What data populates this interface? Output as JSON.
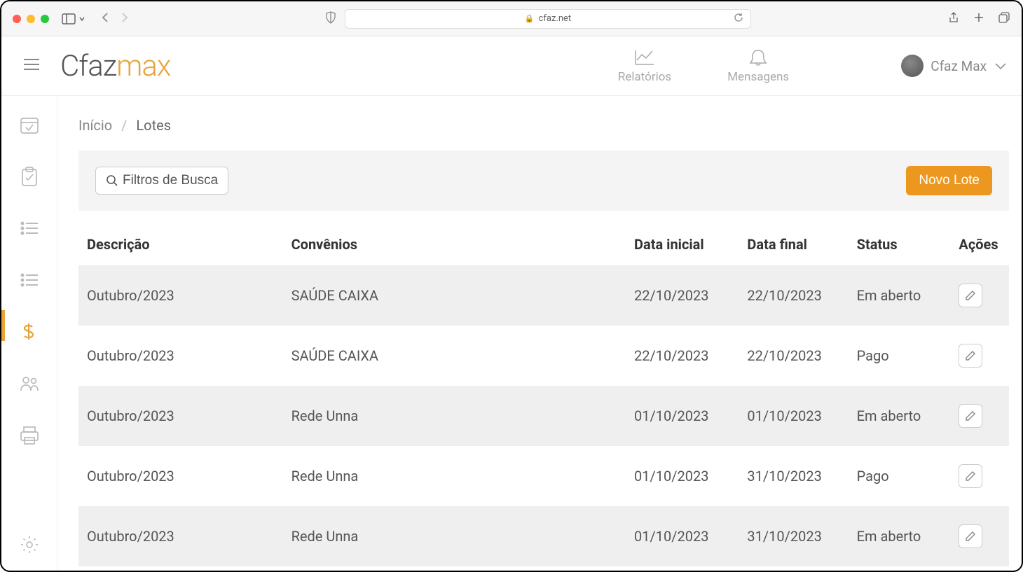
{
  "browser": {
    "url": "cfaz.net"
  },
  "logo": {
    "part1": "Cfaz",
    "part2": "max"
  },
  "header_nav": {
    "reports": "Relatórios",
    "messages": "Mensagens"
  },
  "user": {
    "name": "Cfaz Max"
  },
  "breadcrumb": {
    "home": "Início",
    "current": "Lotes"
  },
  "toolbar": {
    "filter_label": "Filtros de Busca",
    "new_label": "Novo Lote"
  },
  "table": {
    "headers": {
      "descricao": "Descrição",
      "convenios": "Convênios",
      "data_inicial": "Data inicial",
      "data_final": "Data final",
      "status": "Status",
      "acoes": "Ações"
    },
    "rows": [
      {
        "descricao": "Outubro/2023",
        "convenios": "SAÚDE CAIXA",
        "data_inicial": "22/10/2023",
        "data_final": "22/10/2023",
        "status": "Em aberto"
      },
      {
        "descricao": "Outubro/2023",
        "convenios": "SAÚDE CAIXA",
        "data_inicial": "22/10/2023",
        "data_final": "22/10/2023",
        "status": "Pago"
      },
      {
        "descricao": "Outubro/2023",
        "convenios": "Rede Unna",
        "data_inicial": "01/10/2023",
        "data_final": "01/10/2023",
        "status": "Em aberto"
      },
      {
        "descricao": "Outubro/2023",
        "convenios": "Rede Unna",
        "data_inicial": "01/10/2023",
        "data_final": "31/10/2023",
        "status": "Pago"
      },
      {
        "descricao": "Outubro/2023",
        "convenios": "Rede Unna",
        "data_inicial": "01/10/2023",
        "data_final": "31/10/2023",
        "status": "Em aberto"
      }
    ]
  }
}
